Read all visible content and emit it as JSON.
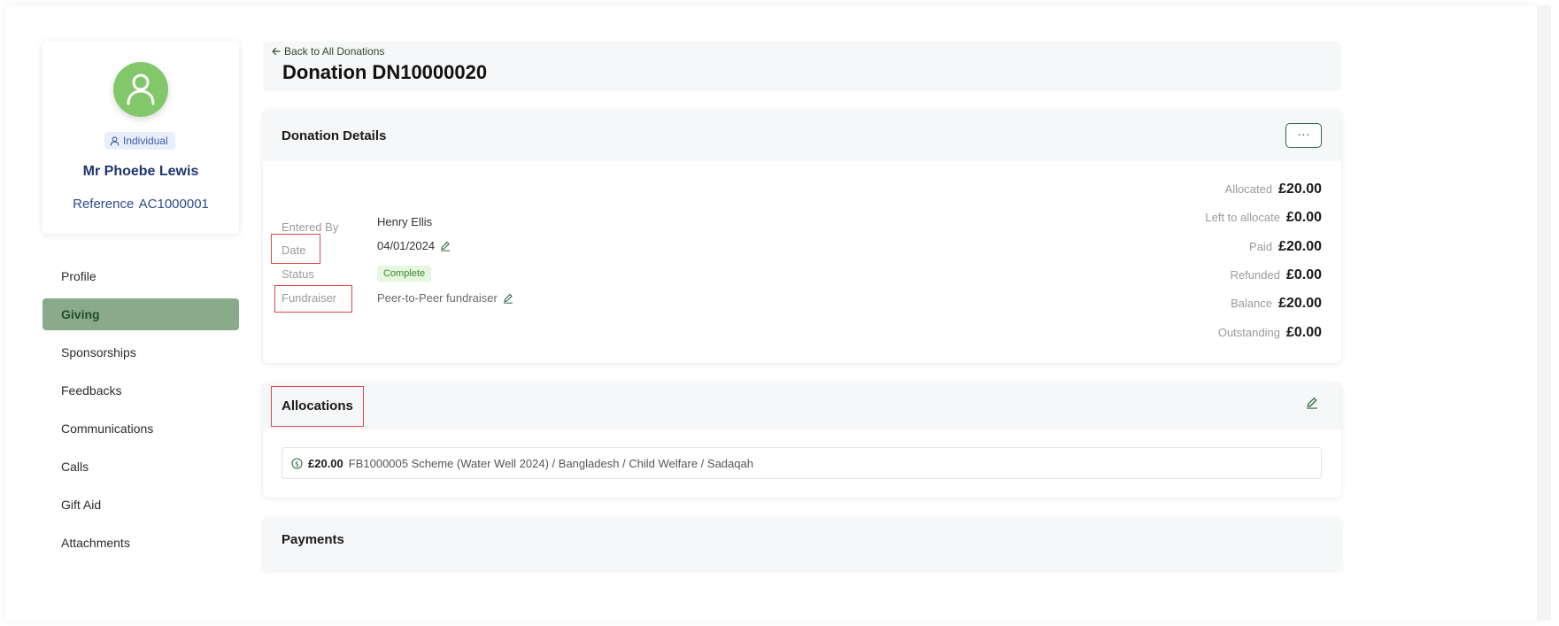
{
  "profile": {
    "type_badge": "Individual",
    "name": "Mr Phoebe Lewis",
    "reference": "Reference  AC1000001"
  },
  "nav": {
    "items": [
      {
        "label": "Profile",
        "active": false
      },
      {
        "label": "Giving",
        "active": true
      },
      {
        "label": "Sponsorships",
        "active": false
      },
      {
        "label": "Feedbacks",
        "active": false
      },
      {
        "label": "Communications",
        "active": false
      },
      {
        "label": "Calls",
        "active": false
      },
      {
        "label": "Gift Aid",
        "active": false
      },
      {
        "label": "Attachments",
        "active": false
      }
    ]
  },
  "header": {
    "back_link": "Back to All Donations",
    "title": "Donation DN10000020"
  },
  "details": {
    "title": "Donation Details",
    "more_label": "···",
    "fields": {
      "entered_by_label": "Entered By",
      "entered_by_value": "Henry Ellis",
      "date_label": "Date",
      "date_value": "04/01/2024",
      "status_label": "Status",
      "status_value": "Complete",
      "fundraiser_label": "Fundraiser",
      "fundraiser_value": "Peer-to-Peer fundraiser"
    },
    "summary": [
      {
        "label": "Allocated",
        "value": "£20.00"
      },
      {
        "label": "Left to allocate",
        "value": "£0.00"
      },
      {
        "label": "Paid",
        "value": "£20.00"
      },
      {
        "label": "Refunded",
        "value": "£0.00"
      },
      {
        "label": "Balance",
        "value": "£20.00"
      },
      {
        "label": "Outstanding",
        "value": "£0.00"
      }
    ]
  },
  "allocations": {
    "title": "Allocations",
    "items": [
      {
        "amount": "£20.00",
        "description": "FB1000005 Scheme (Water Well 2024) / Bangladesh / Child Welfare / Sadaqah"
      }
    ]
  },
  "payments": {
    "title": "Payments"
  },
  "colors": {
    "accent": "#2f6b3d",
    "nav_active_bg": "#8aab8a",
    "avatar_bg": "#82c86a",
    "status_bg": "#e6f6df",
    "highlight": "#e04848"
  },
  "icons": {
    "avatar": "user-icon",
    "badge": "person-icon",
    "back": "arrow-left-icon",
    "edit": "pencil-icon",
    "allocation": "coin-icon"
  }
}
